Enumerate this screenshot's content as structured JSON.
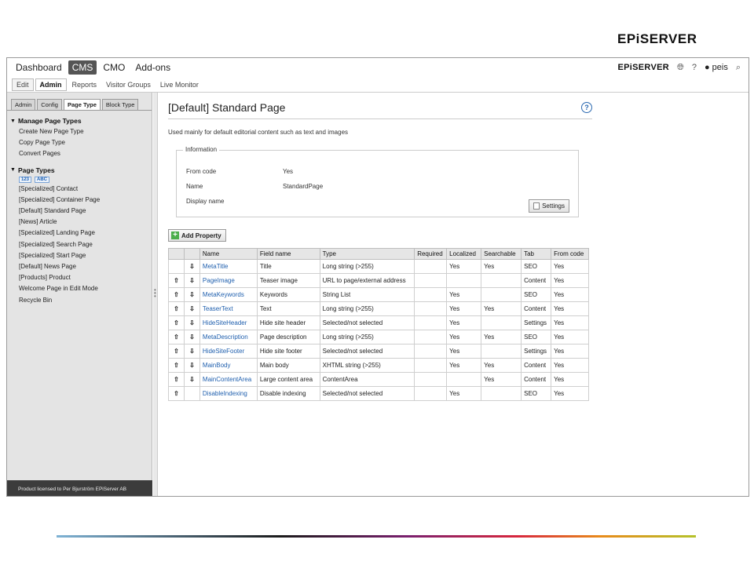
{
  "slide": {
    "logo": "EPiSERVER"
  },
  "topnav": {
    "items": [
      "Dashboard",
      "CMS",
      "CMO",
      "Add-ons"
    ],
    "active": "CMS",
    "brand": "EPiSERVER",
    "help": "?",
    "user": "peis"
  },
  "subnav": {
    "items": [
      "Edit",
      "Admin",
      "Reports",
      "Visitor Groups",
      "Live Monitor"
    ]
  },
  "leftpanel": {
    "tabs": [
      "Admin",
      "Config",
      "Page Type",
      "Block Type"
    ],
    "group1": "Manage Page Types",
    "group1_items": [
      "Create New Page Type",
      "Copy Page Type",
      "Convert Pages"
    ],
    "group2": "Page Types",
    "badges": [
      "123",
      "ABC"
    ],
    "group2_items": [
      "[Specialized] Contact",
      "[Specialized] Container Page",
      "[Default] Standard Page",
      "[News] Article",
      "[Specialized] Landing Page",
      "[Specialized] Search Page",
      "[Specialized] Start Page",
      "[Default] News Page",
      "[Products] Product",
      "Welcome Page in Edit Mode",
      "Recycle Bin"
    ],
    "footer": "Product licensed to Per Bjurström EPiServer AB"
  },
  "main": {
    "title": "[Default] Standard Page",
    "description": "Used mainly for default editorial content such as text and images",
    "info_legend": "Information",
    "info": [
      {
        "label": "From code",
        "value": "Yes"
      },
      {
        "label": "Name",
        "value": "StandardPage"
      },
      {
        "label": "Display name",
        "value": ""
      }
    ],
    "settings_label": "Settings",
    "add_property_label": "Add Property"
  },
  "table": {
    "headers": [
      "Name",
      "Field name",
      "Type",
      "Required",
      "Localized",
      "Searchable",
      "Tab",
      "From code"
    ],
    "rows": [
      {
        "up": false,
        "down": true,
        "name": "MetaTitle",
        "field": "Title",
        "type": "Long string (>255)",
        "required": "",
        "localized": "Yes",
        "searchable": "Yes",
        "tab": "SEO",
        "fromcode": "Yes"
      },
      {
        "up": true,
        "down": true,
        "name": "PageImage",
        "field": "Teaser image",
        "type": "URL to page/external address",
        "required": "",
        "localized": "",
        "searchable": "",
        "tab": "Content",
        "fromcode": "Yes"
      },
      {
        "up": true,
        "down": true,
        "name": "MetaKeywords",
        "field": "Keywords",
        "type": "String List",
        "required": "",
        "localized": "Yes",
        "searchable": "",
        "tab": "SEO",
        "fromcode": "Yes"
      },
      {
        "up": true,
        "down": true,
        "name": "TeaserText",
        "field": "Text",
        "type": "Long string (>255)",
        "required": "",
        "localized": "Yes",
        "searchable": "Yes",
        "tab": "Content",
        "fromcode": "Yes"
      },
      {
        "up": true,
        "down": true,
        "name": "HideSiteHeader",
        "field": "Hide site header",
        "type": "Selected/not selected",
        "required": "",
        "localized": "Yes",
        "searchable": "",
        "tab": "Settings",
        "fromcode": "Yes"
      },
      {
        "up": true,
        "down": true,
        "name": "MetaDescription",
        "field": "Page description",
        "type": "Long string (>255)",
        "required": "",
        "localized": "Yes",
        "searchable": "Yes",
        "tab": "SEO",
        "fromcode": "Yes"
      },
      {
        "up": true,
        "down": true,
        "name": "HideSiteFooter",
        "field": "Hide site footer",
        "type": "Selected/not selected",
        "required": "",
        "localized": "Yes",
        "searchable": "",
        "tab": "Settings",
        "fromcode": "Yes"
      },
      {
        "up": true,
        "down": true,
        "name": "MainBody",
        "field": "Main body",
        "type": "XHTML string (>255)",
        "required": "",
        "localized": "Yes",
        "searchable": "Yes",
        "tab": "Content",
        "fromcode": "Yes"
      },
      {
        "up": true,
        "down": true,
        "name": "MainContentArea",
        "field": "Large content area",
        "type": "ContentArea",
        "required": "",
        "localized": "",
        "searchable": "Yes",
        "tab": "Content",
        "fromcode": "Yes"
      },
      {
        "up": true,
        "down": false,
        "name": "DisableIndexing",
        "field": "Disable indexing",
        "type": "Selected/not selected",
        "required": "",
        "localized": "Yes",
        "searchable": "",
        "tab": "SEO",
        "fromcode": "Yes"
      }
    ]
  }
}
